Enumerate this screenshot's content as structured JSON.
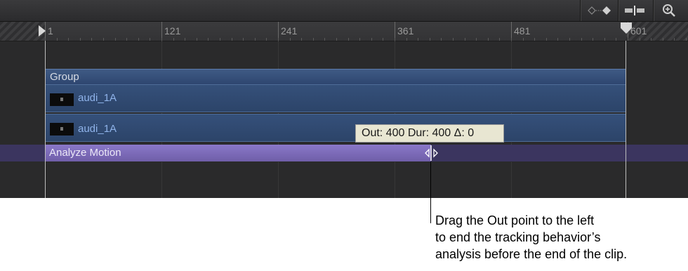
{
  "toolbar": {
    "keyframe_nav_icon": "keyframe-nav-icon",
    "snapping_icon": "snapping-icon",
    "zoom_icon": "zoom-icon"
  },
  "ruler": {
    "ticks": [
      "1",
      "121",
      "241",
      "361",
      "481",
      "601"
    ]
  },
  "tracks": {
    "group_label": "Group",
    "clip1_label": "audi_1A",
    "clip2_label": "audi_1A",
    "behavior_label": "Analyze Motion"
  },
  "tooltip": {
    "text": "Out: 400 Dur: 400 Δ: 0"
  },
  "callout": {
    "line1": "Drag the Out point to the left",
    "line2": "to end the tracking behavior’s",
    "line3": "analysis before the end of the clip."
  },
  "colors": {
    "clip_blue": "#35507a",
    "behavior_purple": "#7a69b8",
    "clip_text": "#8fb3ea"
  }
}
